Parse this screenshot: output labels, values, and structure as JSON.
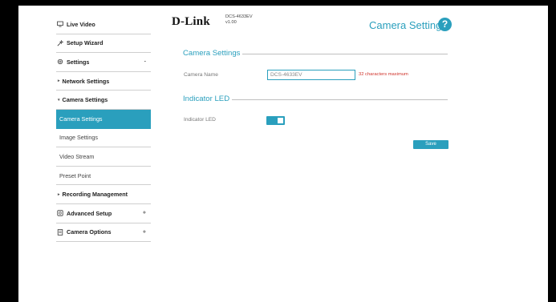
{
  "header": {
    "logo": "D-Link",
    "model": "DCS-4633EV",
    "version": "v1.00",
    "page_title": "Camera Settings",
    "help": "?"
  },
  "sidebar": {
    "items": [
      {
        "label": "Live Video",
        "icon": "monitor-icon",
        "kind": "top"
      },
      {
        "label": "Setup Wizard",
        "icon": "wand-icon",
        "kind": "top"
      },
      {
        "label": "Settings",
        "icon": "gear-icon",
        "kind": "top",
        "tail": "-"
      },
      {
        "label": "Network Settings",
        "kind": "sub"
      },
      {
        "label": "Camera Settings",
        "kind": "sub"
      },
      {
        "label": "Camera Settings",
        "kind": "leaf",
        "active": true
      },
      {
        "label": "Image Settings",
        "kind": "leaf"
      },
      {
        "label": "Video Stream",
        "kind": "leaf"
      },
      {
        "label": "Preset Point",
        "kind": "leaf"
      },
      {
        "label": "Recording Management",
        "kind": "sub"
      },
      {
        "label": "Advanced Setup",
        "icon": "settings-advanced-icon",
        "kind": "top",
        "tail": "+"
      },
      {
        "label": "Camera Options",
        "icon": "document-icon",
        "kind": "top",
        "tail": "+"
      }
    ]
  },
  "camera_settings": {
    "title": "Camera Settings",
    "name_label": "Camera Name",
    "name_value": "DCS-4633EV",
    "name_hint": "32 characters maximum"
  },
  "indicator": {
    "title": "Indicator LED",
    "label": "Indicator LED",
    "enabled": true
  },
  "actions": {
    "save_label": "Save"
  },
  "colors": {
    "accent": "#2a9fbd",
    "hint": "#d0342c"
  }
}
